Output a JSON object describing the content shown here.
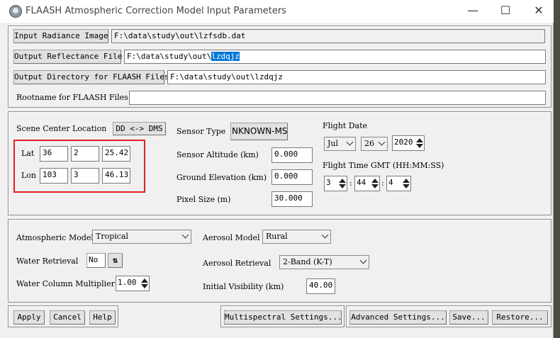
{
  "window": {
    "title": "FLAASH Atmospheric Correction Model Input Parameters",
    "minimize": "—",
    "maximize": "☐",
    "close": "✕"
  },
  "files": {
    "input_radiance_label": "Input Radiance Image",
    "input_radiance_value": "F:\\data\\study\\out\\lzfsdb.dat",
    "output_reflectance_label": "Output Reflectance File",
    "output_reflectance_prefix": "F:\\data\\study\\out\\",
    "output_reflectance_selected": "lzdqjz",
    "output_directory_label": "Output Directory for FLAASH Files",
    "output_directory_value": "F:\\data\\study\\out\\lzdqjz",
    "rootname_label": "Rootname for FLAASH Files",
    "rootname_value": ""
  },
  "scene": {
    "center_label": "Scene Center Location",
    "dd_dms_button": "DD <-> DMS",
    "lat_label": "Lat",
    "lat": [
      "36",
      "2",
      "25.42"
    ],
    "lon_label": "Lon",
    "lon": [
      "103",
      "3",
      "46.13"
    ]
  },
  "sensor": {
    "type_label": "Sensor Type",
    "type_value": "NKNOWN-MS",
    "altitude_label": "Sensor Altitude (km)",
    "altitude_value": "0.000",
    "ground_label": "Ground Elevation (km)",
    "ground_value": "0.000",
    "pixel_label": "Pixel Size (m)",
    "pixel_value": "30.000"
  },
  "flight": {
    "date_label": "Flight Date",
    "month": "Jul",
    "day": "26",
    "year": "2020",
    "time_label": "Flight Time GMT (HH:MM:SS)",
    "hh": "3",
    "mm": "44",
    "ss": "4",
    "sep": ":"
  },
  "atmosphere": {
    "model_label": "Atmospheric Model",
    "model_value": "Tropical",
    "water_retrieval_label": "Water Retrieval",
    "water_retrieval_value": "No",
    "water_column_label": "Water Column Multiplier",
    "water_column_value": "1.00",
    "aerosol_model_label": "Aerosol Model",
    "aerosol_model_value": "Rural",
    "aerosol_retrieval_label": "Aerosol Retrieval",
    "aerosol_retrieval_value": "2-Band (K-T)",
    "visibility_label": "Initial Visibility (km)",
    "visibility_value": "40.00"
  },
  "footer": {
    "apply": "Apply",
    "cancel": "Cancel",
    "help": "Help",
    "multispectral": "Multispectral Settings...",
    "advanced": "Advanced Settings...",
    "save": "Save...",
    "restore": "Restore..."
  }
}
